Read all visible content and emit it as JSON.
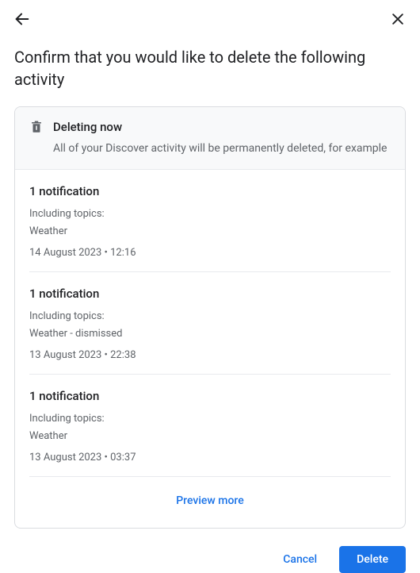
{
  "header": {
    "title": "Confirm that you would like to delete the following activity"
  },
  "banner": {
    "title": "Deleting now",
    "subtitle": "All of your Discover activity will be permanently deleted, for example"
  },
  "items": [
    {
      "title": "1 notification",
      "subtitle": "Including topics:",
      "topic": "Weather",
      "timestamp": "14 August 2023 • 12:16"
    },
    {
      "title": "1 notification",
      "subtitle": "Including topics:",
      "topic": "Weather - dismissed",
      "timestamp": "13 August 2023 • 22:38"
    },
    {
      "title": "1 notification",
      "subtitle": "Including topics:",
      "topic": "Weather",
      "timestamp": "13 August 2023 • 03:37"
    }
  ],
  "preview_more": "Preview more",
  "footer": {
    "cancel": "Cancel",
    "delete": "Delete"
  }
}
